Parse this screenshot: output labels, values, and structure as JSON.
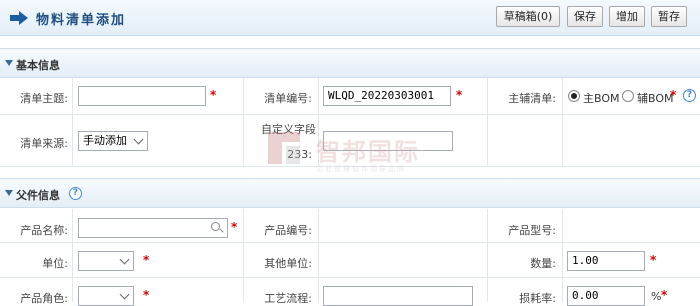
{
  "header": {
    "title": "物料清单添加",
    "buttons": [
      "草稿箱(0)",
      "保存",
      "增加",
      "暂存"
    ]
  },
  "sections": {
    "basic": {
      "title": "基本信息"
    },
    "parent": {
      "title": "父件信息",
      "help": "?"
    }
  },
  "basic": {
    "subject_label": "清单主题:",
    "subject_value": "",
    "code_label": "清单编号:",
    "code_value": "WLQD_20220303001",
    "main_aux_label": "主辅清单:",
    "main_option": "主BOM",
    "aux_option": "辅BOM",
    "selected": "main",
    "help": "?",
    "source_label": "清单来源:",
    "source_value": "手动添加",
    "custom_label_1": "自定义字段",
    "custom_label_2": "233:",
    "custom_value": ""
  },
  "parent": {
    "product_name_label": "产品名称:",
    "product_name_value": "",
    "product_code_label": "产品编号:",
    "product_model_label": "产品型号:",
    "unit_label": "单位:",
    "unit_value": "",
    "other_unit_label": "其他单位:",
    "qty_label": "数量:",
    "qty_value": "1.00",
    "role_label": "产品角色:",
    "process_label": "工艺流程:",
    "loss_label": "损耗率:",
    "loss_value": "0.00",
    "loss_unit": "%"
  },
  "required_mark": "*",
  "watermark": {
    "brand": "智邦国际",
    "tagline": "企业管理软件领导品牌"
  },
  "colors": {
    "title": "#1f4f82",
    "required": "#d80000",
    "border": "#dfe6ed"
  }
}
